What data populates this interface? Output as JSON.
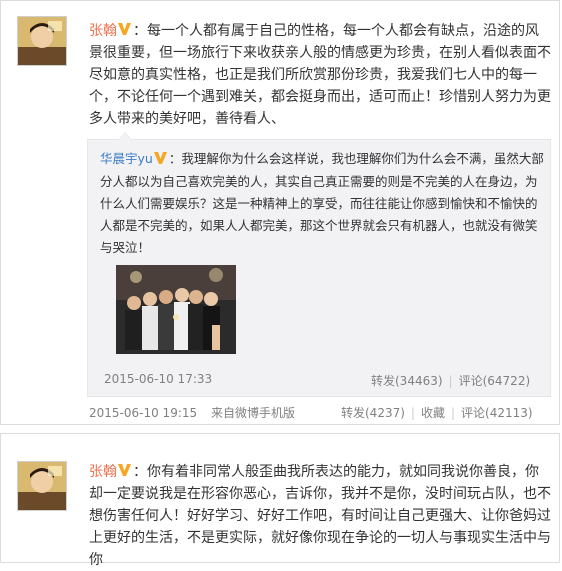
{
  "post1": {
    "username": "张翰",
    "content": "：每一个人都有属于自己的性格，每一个人都会有缺点，沿途的风景很重要，但一场旅行下来收获亲人般的情感更为珍贵，在别人看似表面不尽如意的真实性格，也正是我们所欣赏那份珍贵，我爱我们七人中的每一个，不论任何一个遇到难关，都会挺身而出，适可而止！珍惜别人努力为更多人带来的美好吧，善待看人、",
    "forward": {
      "username": "华晨宇yu",
      "content": "：我理解你为什么会这样说，我也理解你们为什么会不满，虽然大部分人都以为自己喜欢完美的人，其实自己真正需要的则是不完美的人在身边，为什么人们需要娱乐？这是一种精神上的享受，而往往能让你感到愉快和不愉快的人都是不完美的，如果人人都完美，那这个世界就会只有机器人，也就没有微笑与哭泣！",
      "timestamp": "2015-06-10 17:33",
      "repost_label": "转发(34463)",
      "comment_label": "评论(64722)"
    },
    "timestamp": "2015-06-10 19:15",
    "source": "来自微博手机版",
    "repost_label": "转发(4237)",
    "favorite_label": "收藏",
    "comment_label": "评论(42113)"
  },
  "post2": {
    "username": "张翰",
    "content": "：你有着非同常人般歪曲我所表达的能力，就如同我说你善良，你却一定要说我是在形容你恶心，吉诉你，我并不是你，没时间玩占队，也不想伤害任何人！好好学习、好好工作吧，有时间让自己更强大、让你爸妈过上更好的生活，不是更实际，就好像你现在争论的一切人与事现实生活中与你"
  },
  "colors": {
    "username_orange": "#eb7350",
    "link_blue": "#3c7dc4",
    "meta_gray": "#808080",
    "forward_bg": "#f2f2f5",
    "verified_badge": "#f5a623"
  },
  "icons": {
    "verified": "verified-v-icon"
  }
}
